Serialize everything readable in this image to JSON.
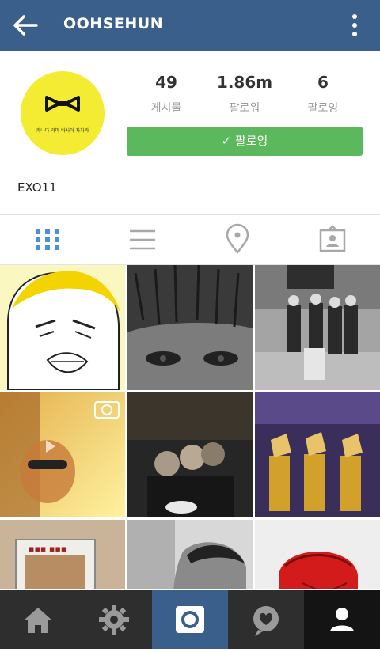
{
  "header": {
    "title": "OOHSEHUN"
  },
  "profile": {
    "avatar_caption": "카나다 라마 바사아 자차카",
    "stats": [
      {
        "value": "49",
        "label": "게시물"
      },
      {
        "value": "1.86m",
        "label": "팔로워"
      },
      {
        "value": "6",
        "label": "팔로잉"
      }
    ],
    "follow_button": "✓ 팔로잉",
    "username": "EXO11"
  },
  "colors": {
    "topbar": "#3a5f8a",
    "follow_button": "#5cb85c",
    "avatar_bg": "#f4ec33",
    "active_tab": "#4a90d9",
    "bottom_bar": "#2e2e2e",
    "camera_tab": "#3a5f8a"
  },
  "tabs": [
    "grid-icon",
    "list-icon",
    "location-icon",
    "tagged-icon"
  ],
  "bottom_nav": [
    "home-icon",
    "explore-icon",
    "camera-icon",
    "activity-icon",
    "profile-icon"
  ]
}
